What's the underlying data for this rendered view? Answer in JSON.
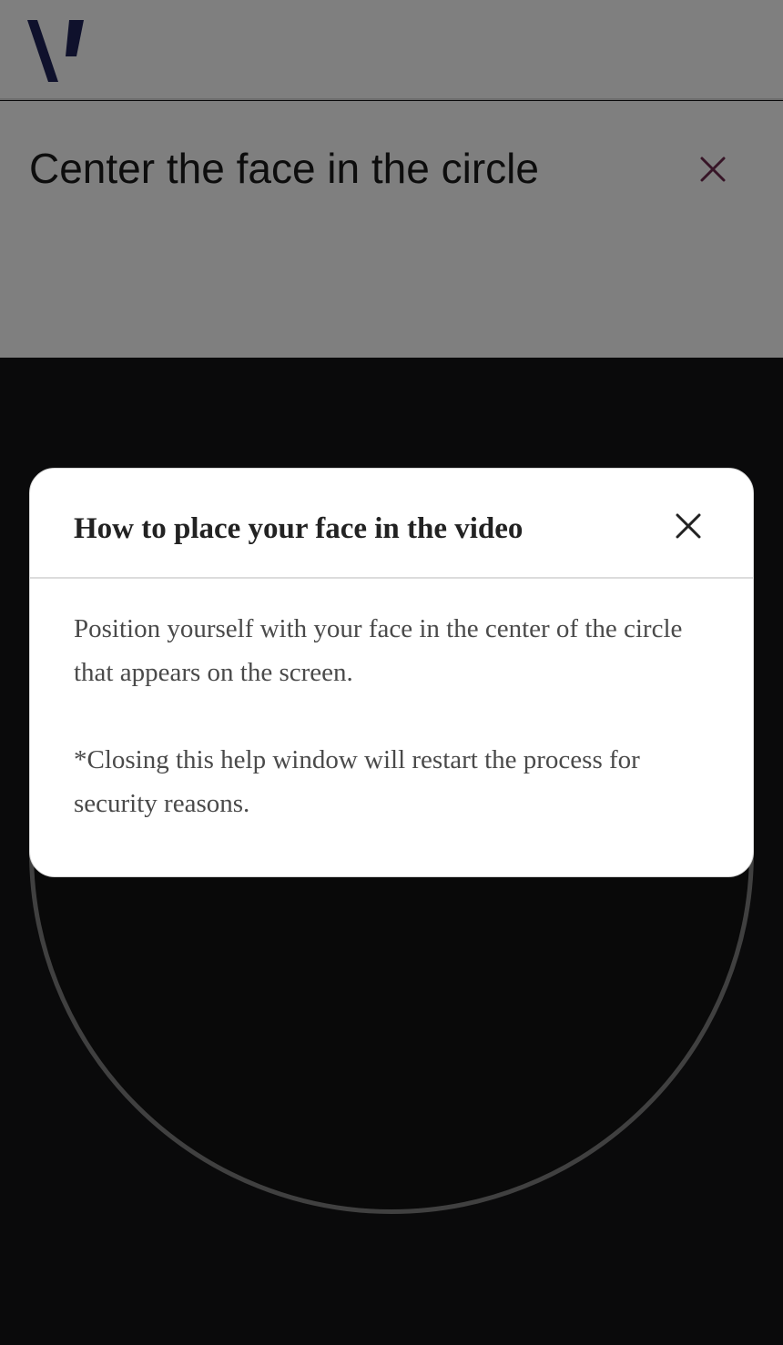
{
  "header": {
    "logo_icon": "brand-v-logo-icon",
    "title": "Center the face in the circle",
    "close_icon": "close-icon",
    "close_color": "#6e2a4f"
  },
  "camera": {
    "guide": "face-circle"
  },
  "modal": {
    "title": "How to place your face in the video",
    "close_icon": "close-icon",
    "paragraphs": [
      "Position yourself with your face in the center of the circle that appears on the screen.",
      "*Closing this help window will restart the process for security reasons."
    ]
  },
  "colors": {
    "brand_navy": "#1e2258",
    "accent_close": "#6e2a4f",
    "camera_bg": "#151516",
    "circle_stroke": "#808080"
  }
}
